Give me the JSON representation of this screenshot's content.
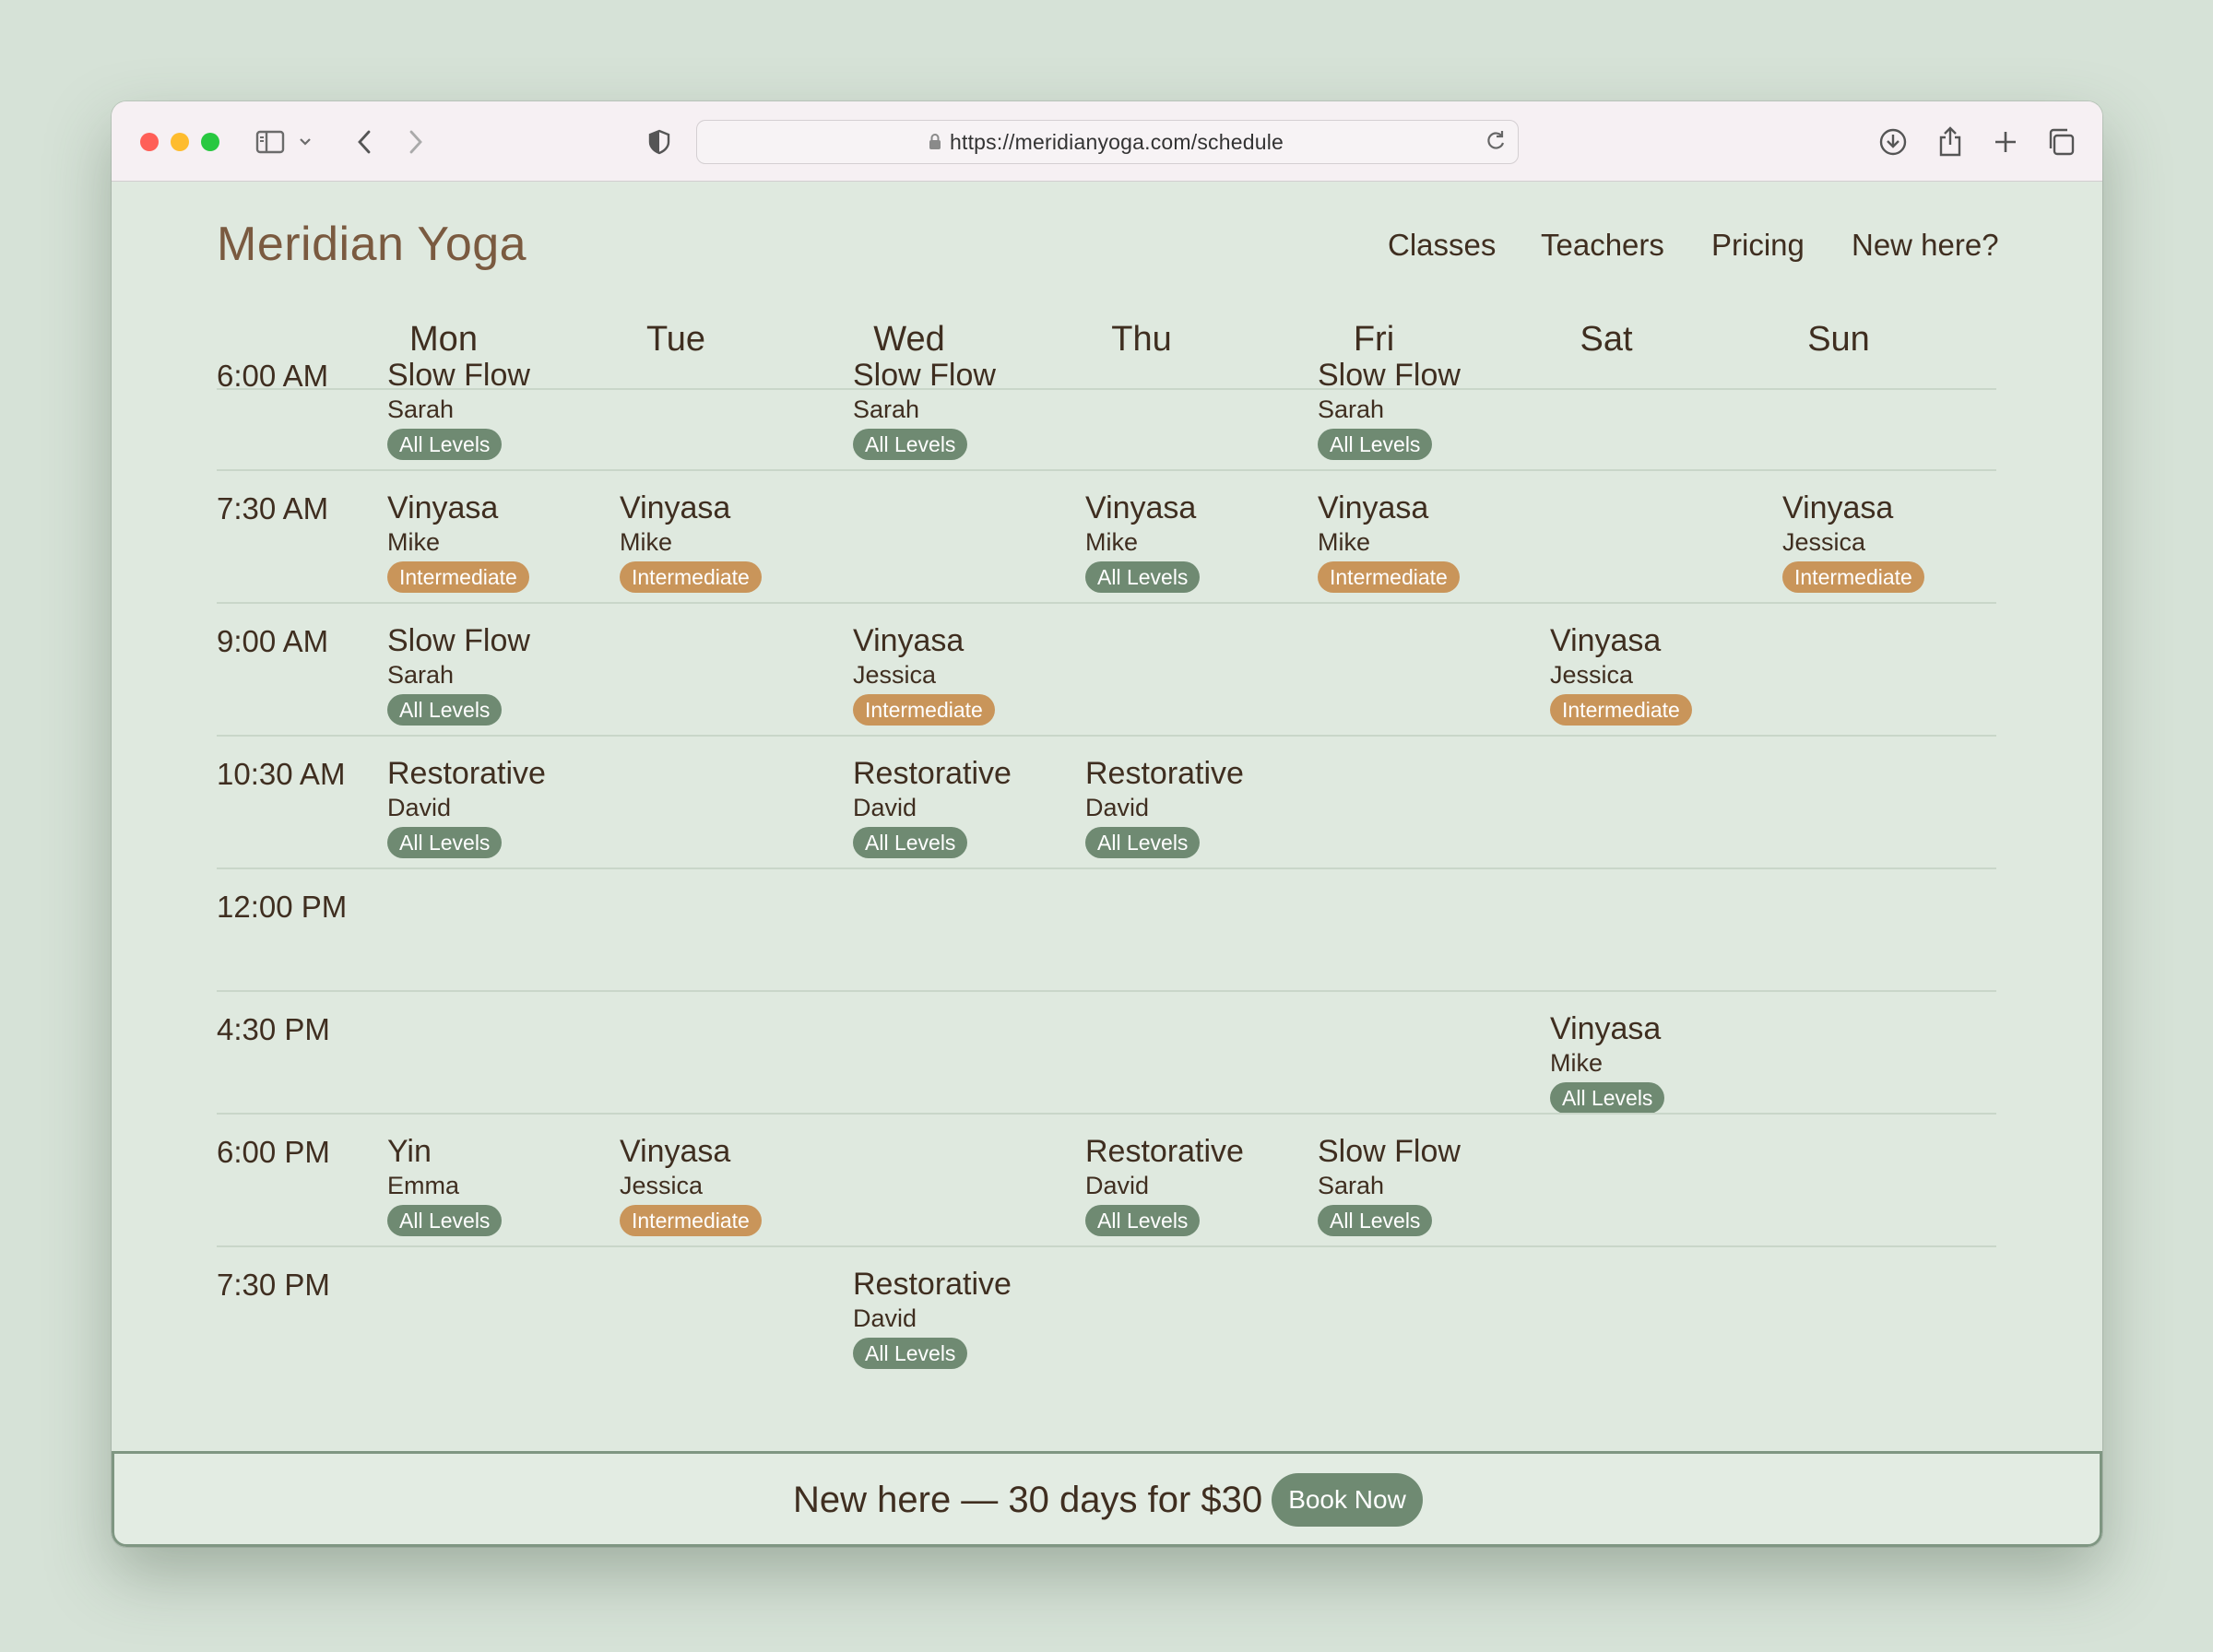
{
  "browser": {
    "url": "https://meridianyoga.com/schedule",
    "traffic_lights": [
      "#ff5f57",
      "#febc2e",
      "#28c840"
    ]
  },
  "site": {
    "brand": "Meridian Yoga",
    "nav": [
      "Classes",
      "Teachers",
      "Pricing",
      "New here?"
    ]
  },
  "colors": {
    "all_levels": "#6f8a72",
    "intermediate": "#c9955a"
  },
  "schedule": {
    "days": [
      "Mon",
      "Tue",
      "Wed",
      "Thu",
      "Fri",
      "Sat",
      "Sun"
    ],
    "slots": [
      {
        "time": "6:00 AM",
        "classes": [
          {
            "day": 0,
            "name": "Slow Flow",
            "teacher": "Sarah",
            "level": "All Levels"
          },
          {
            "day": 2,
            "name": "Slow Flow",
            "teacher": "Sarah",
            "level": "All Levels"
          },
          {
            "day": 4,
            "name": "Slow Flow",
            "teacher": "Sarah",
            "level": "All Levels"
          }
        ]
      },
      {
        "time": "7:30 AM",
        "classes": [
          {
            "day": 0,
            "name": "Vinyasa",
            "teacher": "Mike",
            "level": "Intermediate"
          },
          {
            "day": 1,
            "name": "Vinyasa",
            "teacher": "Mike",
            "level": "Intermediate"
          },
          {
            "day": 3,
            "name": "Vinyasa",
            "teacher": "Mike",
            "level": "All Levels"
          },
          {
            "day": 4,
            "name": "Vinyasa",
            "teacher": "Mike",
            "level": "Intermediate"
          },
          {
            "day": 6,
            "name": "Vinyasa",
            "teacher": "Jessica",
            "level": "Intermediate"
          }
        ]
      },
      {
        "time": "9:00 AM",
        "classes": [
          {
            "day": 0,
            "name": "Slow Flow",
            "teacher": "Sarah",
            "level": "All Levels"
          },
          {
            "day": 2,
            "name": "Vinyasa",
            "teacher": "Jessica",
            "level": "Intermediate"
          },
          {
            "day": 5,
            "name": "Vinyasa",
            "teacher": "Jessica",
            "level": "Intermediate"
          }
        ]
      },
      {
        "time": "10:30 AM",
        "classes": [
          {
            "day": 0,
            "name": "Restorative",
            "teacher": "David",
            "level": "All Levels"
          },
          {
            "day": 2,
            "name": "Restorative",
            "teacher": "David",
            "level": "All Levels"
          },
          {
            "day": 3,
            "name": "Restorative",
            "teacher": "David",
            "level": "All Levels"
          }
        ]
      },
      {
        "time": "12:00 PM",
        "classes": []
      },
      {
        "time": "4:30 PM",
        "classes": [
          {
            "day": 5,
            "name": "Vinyasa",
            "teacher": "Mike",
            "level": "All Levels"
          }
        ]
      },
      {
        "time": "6:00 PM",
        "classes": [
          {
            "day": 0,
            "name": "Yin",
            "teacher": "Emma",
            "level": "All Levels"
          },
          {
            "day": 1,
            "name": "Vinyasa",
            "teacher": "Jessica",
            "level": "Intermediate"
          },
          {
            "day": 3,
            "name": "Restorative",
            "teacher": "David",
            "level": "All Levels"
          },
          {
            "day": 4,
            "name": "Slow Flow",
            "teacher": "Sarah",
            "level": "All Levels"
          }
        ]
      },
      {
        "time": "7:30 PM",
        "classes": [
          {
            "day": 2,
            "name": "Restorative",
            "teacher": "David",
            "level": "All Levels"
          }
        ]
      }
    ]
  },
  "banner": {
    "text": "New here — 30 days for $30",
    "button": "Book Now"
  }
}
